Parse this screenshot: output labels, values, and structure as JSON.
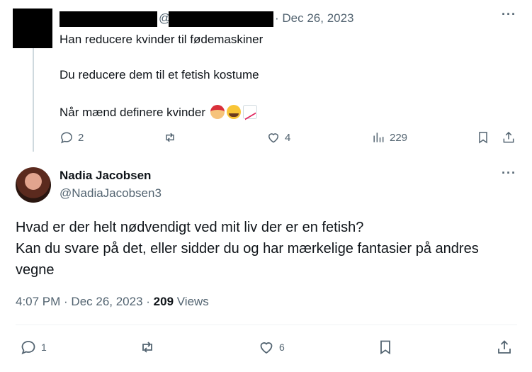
{
  "parent_tweet": {
    "handle_separator": "@",
    "date": "· Dec 26, 2023",
    "more": "···",
    "lines": [
      "Han reducere kvinder til fødemaskiner",
      "Du reducere dem til et fetish kostume",
      "Når mænd definere kvinder"
    ],
    "emoji_icons": [
      "santa-emoji-icon",
      "joy-emoji-icon",
      "chart-increasing-emoji-icon"
    ],
    "stats": {
      "replies": "2",
      "likes": "4",
      "views": "229"
    }
  },
  "main_tweet": {
    "author_name": "Nadia Jacobsen",
    "author_handle": "@NadiaJacobsen3",
    "more": "···",
    "body_lines": [
      "Hvad er der helt nødvendigt ved mit liv der er en fetish?",
      "Kan du svare på det, eller sidder du og har mærkelige fantasier på andres",
      "vegne"
    ],
    "time_date": "4:07 PM · Dec 26, 2023",
    "meta_separator": " · ",
    "views_count": "209",
    "views_label": " Views",
    "stats": {
      "replies": "1",
      "likes": "6"
    }
  },
  "colors": {
    "text": "#0f1419",
    "muted": "#536471",
    "divider": "#eff3f4",
    "thread_line": "#cfd9de"
  }
}
